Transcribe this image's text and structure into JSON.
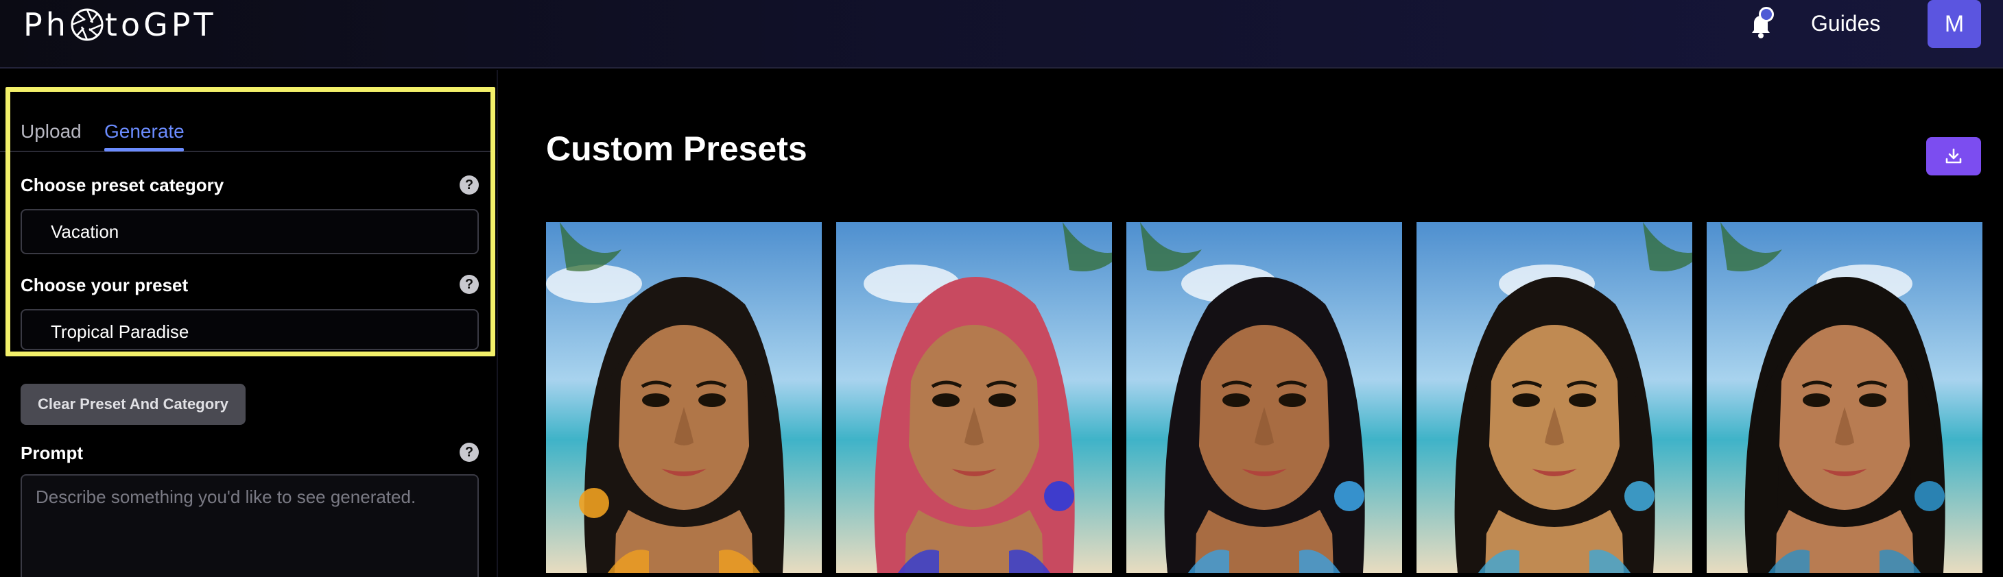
{
  "app": {
    "brand": "PhotoGPT"
  },
  "header": {
    "guides_label": "Guides",
    "avatar_initial": "M"
  },
  "left": {
    "tabs": [
      {
        "label": "Upload"
      },
      {
        "label": "Generate"
      }
    ],
    "category": {
      "label": "Choose preset category",
      "value": "Vacation",
      "help": "?"
    },
    "preset": {
      "label": "Choose your preset",
      "value": "Tropical Paradise",
      "help": "?"
    },
    "clear_button": "Clear Preset And Category",
    "prompt": {
      "label": "Prompt",
      "placeholder": "Describe something you'd like to see generated.",
      "help": "?"
    }
  },
  "main": {
    "title": "Custom Presets",
    "download_icon": "download-icon",
    "images": [
      {
        "name": "preset-image-1",
        "hair": "#1a1410",
        "accent": "#f0a020",
        "skin": "#b07648"
      },
      {
        "name": "preset-image-2",
        "hair": "#c84a60",
        "accent": "#2f3bd8",
        "skin": "#b47a4e"
      },
      {
        "name": "preset-image-3",
        "hair": "#141014",
        "accent": "#3aa0e0",
        "skin": "#a86c42"
      },
      {
        "name": "preset-image-4",
        "hair": "#18120e",
        "accent": "#3fa6d6",
        "skin": "#c08a52"
      },
      {
        "name": "preset-image-5",
        "hair": "#130f0c",
        "accent": "#2d8fc4",
        "skin": "#b87c52"
      }
    ]
  },
  "colors": {
    "accent_blue": "#6b8cff",
    "highlight": "#f3f06a",
    "download_purple": "#7c4df0",
    "avatar_purple": "#5b55e0"
  }
}
